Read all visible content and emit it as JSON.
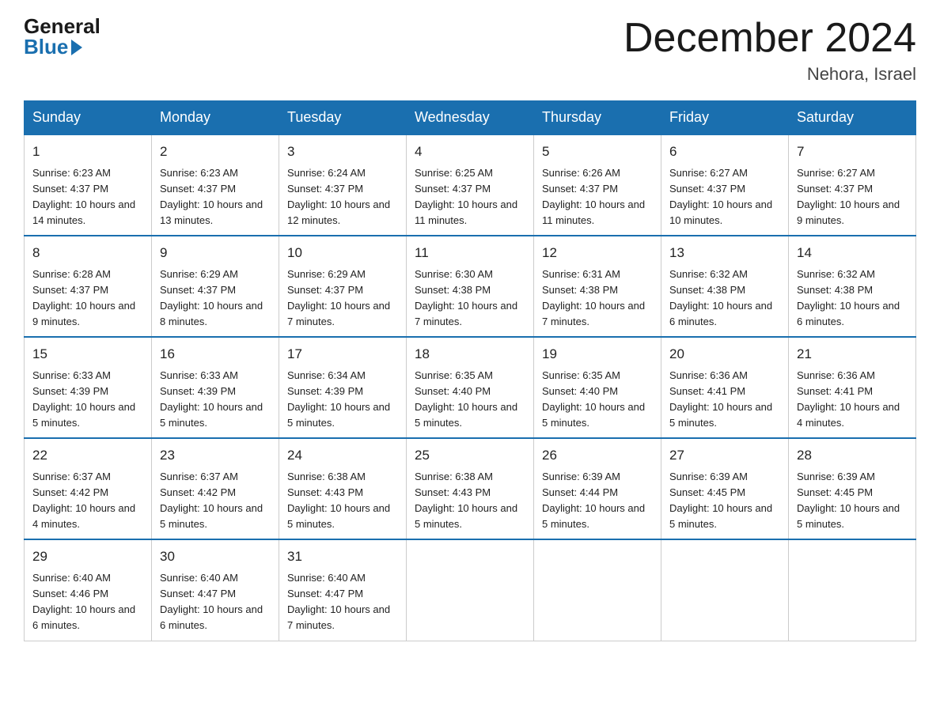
{
  "logo": {
    "general": "General",
    "blue": "Blue"
  },
  "title": "December 2024",
  "subtitle": "Nehora, Israel",
  "headers": [
    "Sunday",
    "Monday",
    "Tuesday",
    "Wednesday",
    "Thursday",
    "Friday",
    "Saturday"
  ],
  "weeks": [
    [
      {
        "day": "1",
        "sunrise": "6:23 AM",
        "sunset": "4:37 PM",
        "daylight": "10 hours and 14 minutes."
      },
      {
        "day": "2",
        "sunrise": "6:23 AM",
        "sunset": "4:37 PM",
        "daylight": "10 hours and 13 minutes."
      },
      {
        "day": "3",
        "sunrise": "6:24 AM",
        "sunset": "4:37 PM",
        "daylight": "10 hours and 12 minutes."
      },
      {
        "day": "4",
        "sunrise": "6:25 AM",
        "sunset": "4:37 PM",
        "daylight": "10 hours and 11 minutes."
      },
      {
        "day": "5",
        "sunrise": "6:26 AM",
        "sunset": "4:37 PM",
        "daylight": "10 hours and 11 minutes."
      },
      {
        "day": "6",
        "sunrise": "6:27 AM",
        "sunset": "4:37 PM",
        "daylight": "10 hours and 10 minutes."
      },
      {
        "day": "7",
        "sunrise": "6:27 AM",
        "sunset": "4:37 PM",
        "daylight": "10 hours and 9 minutes."
      }
    ],
    [
      {
        "day": "8",
        "sunrise": "6:28 AM",
        "sunset": "4:37 PM",
        "daylight": "10 hours and 9 minutes."
      },
      {
        "day": "9",
        "sunrise": "6:29 AM",
        "sunset": "4:37 PM",
        "daylight": "10 hours and 8 minutes."
      },
      {
        "day": "10",
        "sunrise": "6:29 AM",
        "sunset": "4:37 PM",
        "daylight": "10 hours and 7 minutes."
      },
      {
        "day": "11",
        "sunrise": "6:30 AM",
        "sunset": "4:38 PM",
        "daylight": "10 hours and 7 minutes."
      },
      {
        "day": "12",
        "sunrise": "6:31 AM",
        "sunset": "4:38 PM",
        "daylight": "10 hours and 7 minutes."
      },
      {
        "day": "13",
        "sunrise": "6:32 AM",
        "sunset": "4:38 PM",
        "daylight": "10 hours and 6 minutes."
      },
      {
        "day": "14",
        "sunrise": "6:32 AM",
        "sunset": "4:38 PM",
        "daylight": "10 hours and 6 minutes."
      }
    ],
    [
      {
        "day": "15",
        "sunrise": "6:33 AM",
        "sunset": "4:39 PM",
        "daylight": "10 hours and 5 minutes."
      },
      {
        "day": "16",
        "sunrise": "6:33 AM",
        "sunset": "4:39 PM",
        "daylight": "10 hours and 5 minutes."
      },
      {
        "day": "17",
        "sunrise": "6:34 AM",
        "sunset": "4:39 PM",
        "daylight": "10 hours and 5 minutes."
      },
      {
        "day": "18",
        "sunrise": "6:35 AM",
        "sunset": "4:40 PM",
        "daylight": "10 hours and 5 minutes."
      },
      {
        "day": "19",
        "sunrise": "6:35 AM",
        "sunset": "4:40 PM",
        "daylight": "10 hours and 5 minutes."
      },
      {
        "day": "20",
        "sunrise": "6:36 AM",
        "sunset": "4:41 PM",
        "daylight": "10 hours and 5 minutes."
      },
      {
        "day": "21",
        "sunrise": "6:36 AM",
        "sunset": "4:41 PM",
        "daylight": "10 hours and 4 minutes."
      }
    ],
    [
      {
        "day": "22",
        "sunrise": "6:37 AM",
        "sunset": "4:42 PM",
        "daylight": "10 hours and 4 minutes."
      },
      {
        "day": "23",
        "sunrise": "6:37 AM",
        "sunset": "4:42 PM",
        "daylight": "10 hours and 5 minutes."
      },
      {
        "day": "24",
        "sunrise": "6:38 AM",
        "sunset": "4:43 PM",
        "daylight": "10 hours and 5 minutes."
      },
      {
        "day": "25",
        "sunrise": "6:38 AM",
        "sunset": "4:43 PM",
        "daylight": "10 hours and 5 minutes."
      },
      {
        "day": "26",
        "sunrise": "6:39 AM",
        "sunset": "4:44 PM",
        "daylight": "10 hours and 5 minutes."
      },
      {
        "day": "27",
        "sunrise": "6:39 AM",
        "sunset": "4:45 PM",
        "daylight": "10 hours and 5 minutes."
      },
      {
        "day": "28",
        "sunrise": "6:39 AM",
        "sunset": "4:45 PM",
        "daylight": "10 hours and 5 minutes."
      }
    ],
    [
      {
        "day": "29",
        "sunrise": "6:40 AM",
        "sunset": "4:46 PM",
        "daylight": "10 hours and 6 minutes."
      },
      {
        "day": "30",
        "sunrise": "6:40 AM",
        "sunset": "4:47 PM",
        "daylight": "10 hours and 6 minutes."
      },
      {
        "day": "31",
        "sunrise": "6:40 AM",
        "sunset": "4:47 PM",
        "daylight": "10 hours and 7 minutes."
      },
      null,
      null,
      null,
      null
    ]
  ]
}
